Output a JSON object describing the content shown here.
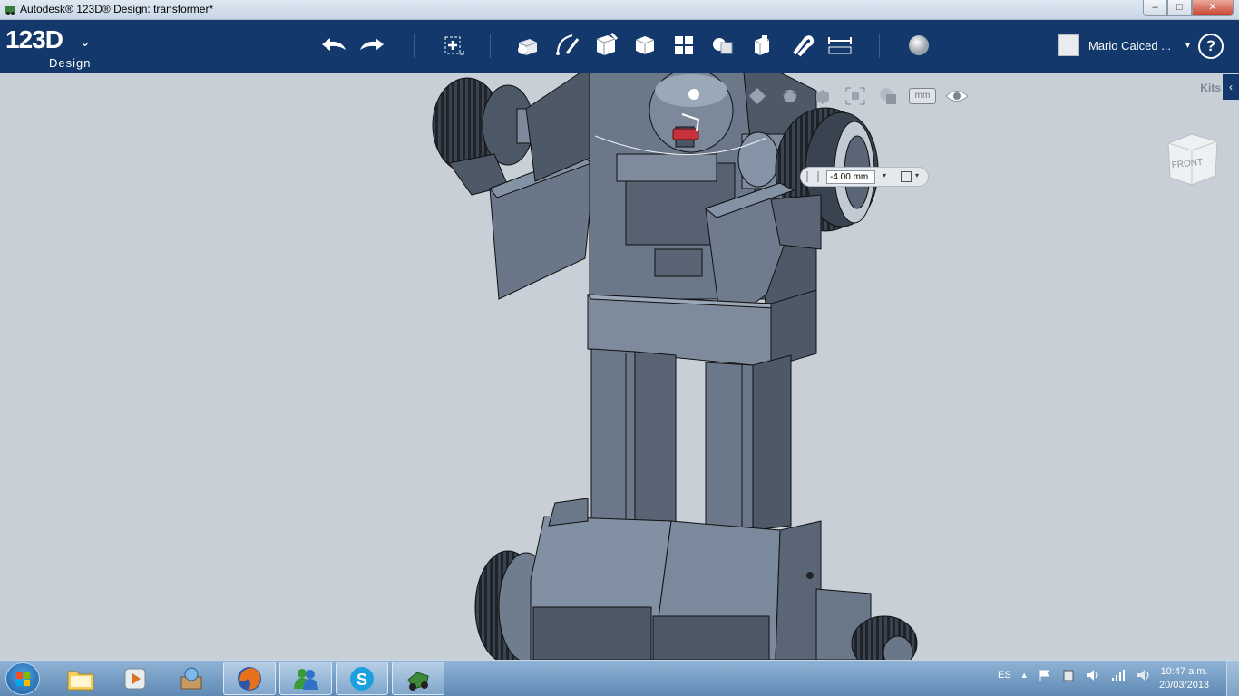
{
  "window": {
    "title": "Autodesk® 123D® Design: transformer*",
    "controls": {
      "minimize": "–",
      "maximize": "□",
      "close": "✕"
    }
  },
  "toolbar": {
    "logo_main": "123D",
    "logo_sub": "Design",
    "logo_caret": "⌄",
    "buttons": [
      {
        "name": "undo-button",
        "icon": "undo-icon"
      },
      {
        "name": "redo-button",
        "icon": "redo-icon"
      },
      {
        "name": "transform-button",
        "icon": "transform-icon"
      },
      {
        "name": "primitives-button",
        "icon": "primitives-icon"
      },
      {
        "name": "sketch-button",
        "icon": "sketch-icon"
      },
      {
        "name": "construct-button",
        "icon": "construct-icon"
      },
      {
        "name": "modify-button",
        "icon": "modify-icon"
      },
      {
        "name": "pattern-button",
        "icon": "pattern-icon"
      },
      {
        "name": "grouping-button",
        "icon": "grouping-icon"
      },
      {
        "name": "combine-button",
        "icon": "combine-icon"
      },
      {
        "name": "snap-button",
        "icon": "snap-icon"
      },
      {
        "name": "measure-button",
        "icon": "measure-icon"
      },
      {
        "name": "material-button",
        "icon": "material-icon"
      }
    ],
    "user_name": "Mario Caiced ...",
    "user_caret": "▾",
    "help_label": "?"
  },
  "viewport": {
    "kits_label": "Kits",
    "kits_tab_arrow": "‹",
    "viewcube_label": "FRONT",
    "unit_label": "mm",
    "dimension_value": "-4.00 mm",
    "dropdown_arrow": "▾"
  },
  "taskbar": {
    "apps": [
      {
        "name": "windows-explorer-task",
        "icon": "folder-icon"
      },
      {
        "name": "media-player-task",
        "icon": "media-player-icon"
      },
      {
        "name": "app-task",
        "icon": "box-icon"
      },
      {
        "name": "firefox-task",
        "icon": "firefox-icon"
      },
      {
        "name": "messenger-task",
        "icon": "messenger-icon"
      },
      {
        "name": "skype-task",
        "icon": "skype-icon"
      },
      {
        "name": "123d-design-task",
        "icon": "123d-icon"
      }
    ],
    "language": "ES",
    "time": "10:47 a.m.",
    "date": "20/03/2013"
  },
  "colors": {
    "toolbar_bg": "#13386b",
    "viewport_bg": "#c9cfd6",
    "model_body": "#5f6d7f"
  }
}
